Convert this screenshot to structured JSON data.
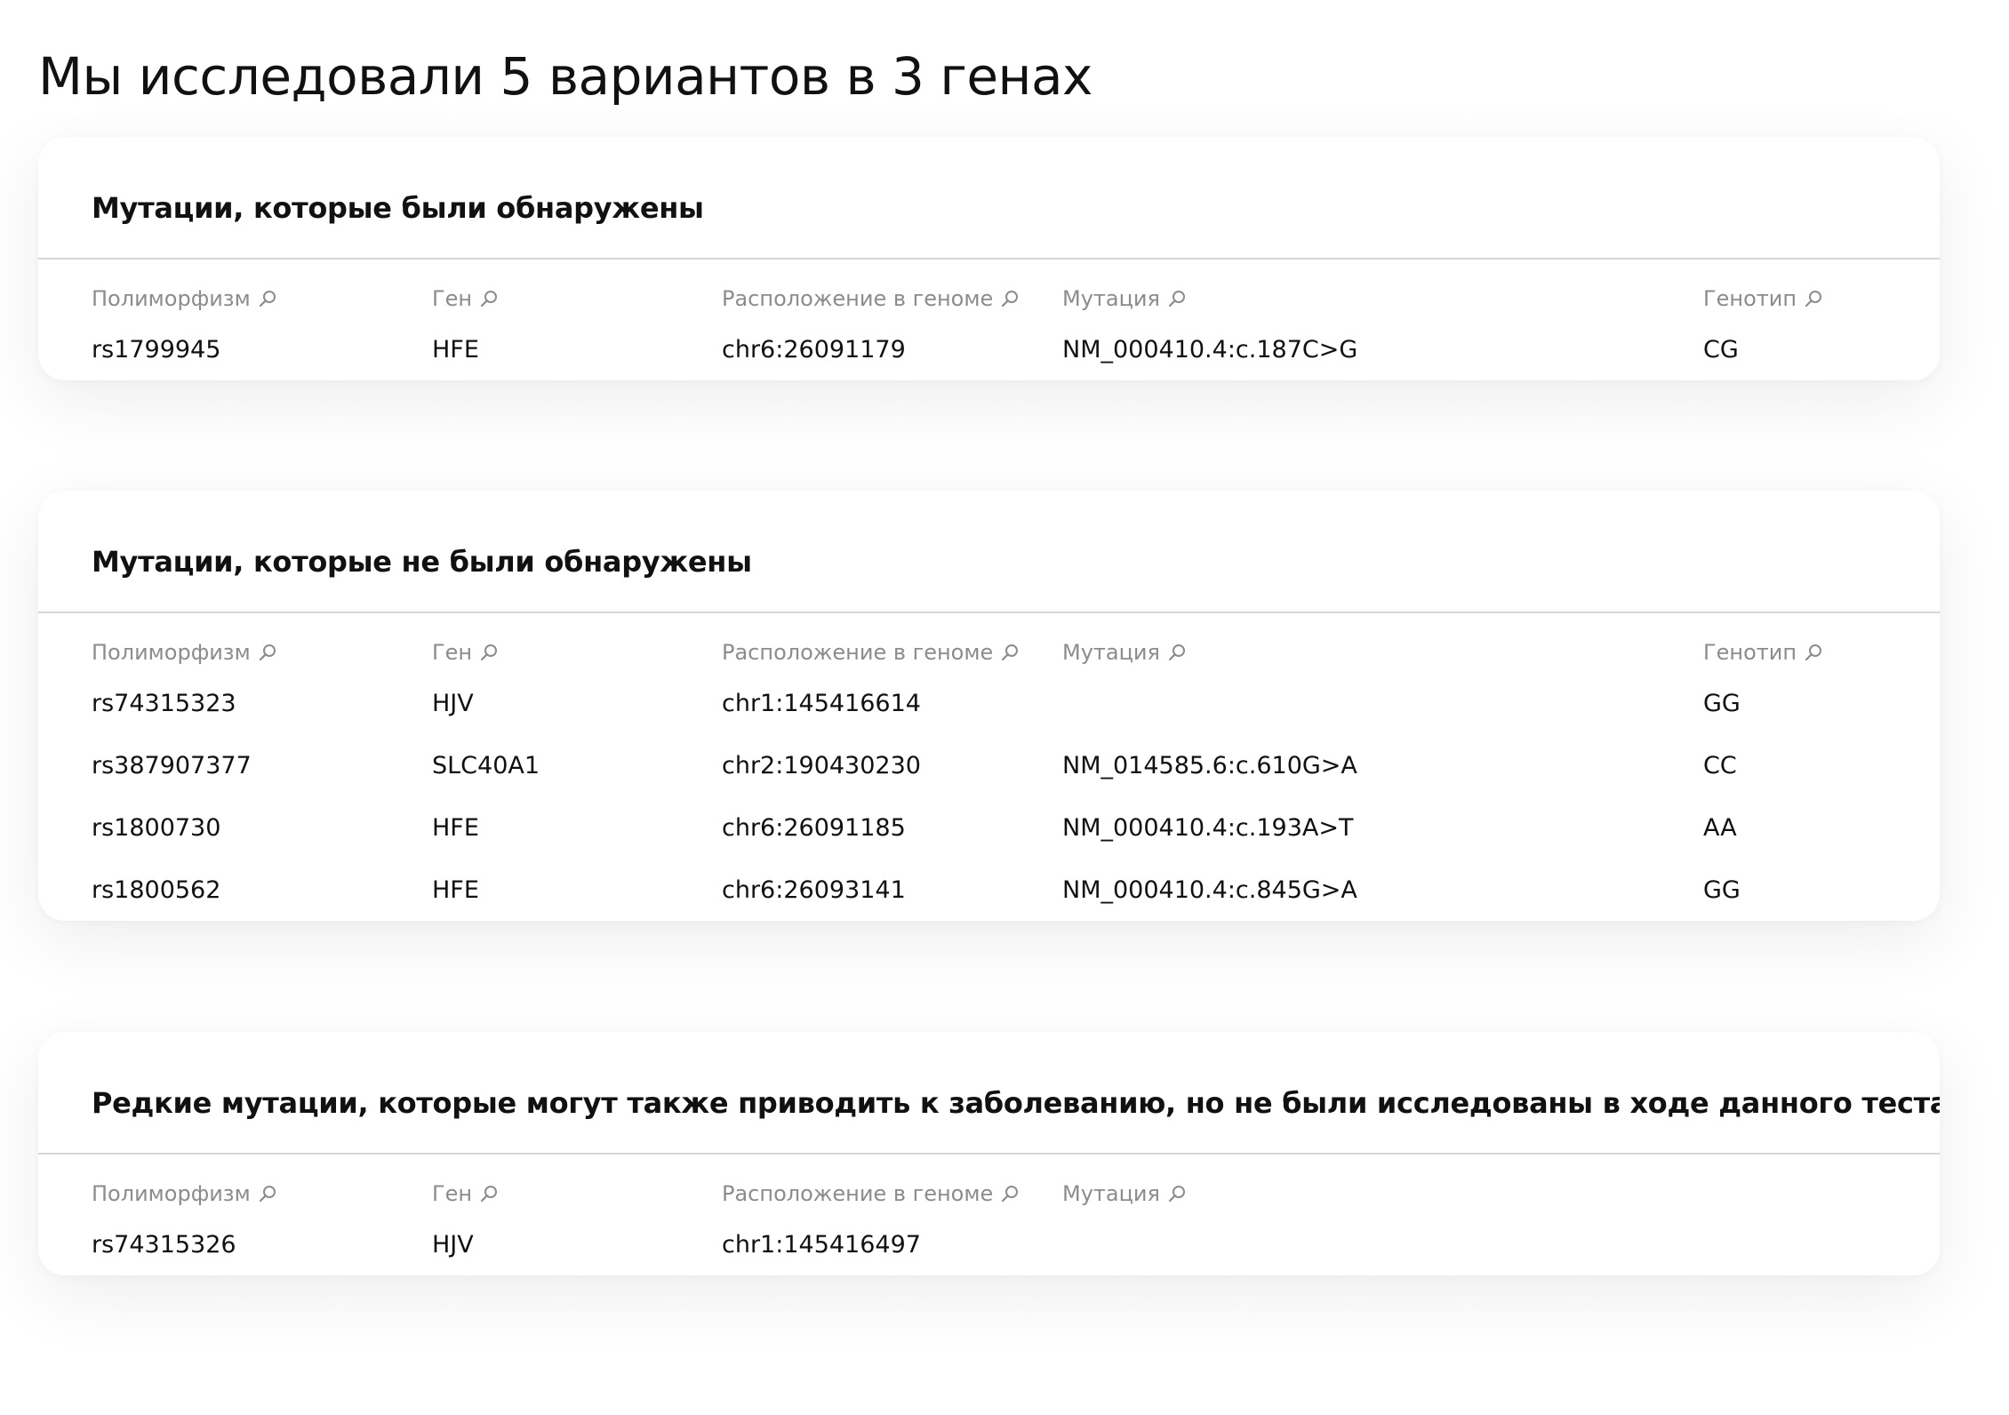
{
  "page": {
    "title": "Мы исследовали 5 вариантов в 3 генах"
  },
  "columns": {
    "polymorphism": "Полиморфизм",
    "gene": "Ген",
    "location": "Расположение в геноме",
    "mutation": "Мутация",
    "genotype": "Генотип"
  },
  "icons": {
    "column_search": "search-icon"
  },
  "sections": [
    {
      "title": "Мутации, которые были обнаружены",
      "rows": [
        {
          "polymorphism": "rs1799945",
          "gene": "HFE",
          "location": "chr6:26091179",
          "mutation": "NM_000410.4:c.187C>G",
          "genotype": "CG"
        }
      ]
    },
    {
      "title": "Мутации, которые не были обнаружены",
      "rows": [
        {
          "polymorphism": "rs74315323",
          "gene": "HJV",
          "location": "chr1:145416614",
          "mutation": "",
          "genotype": "GG"
        },
        {
          "polymorphism": "rs387907377",
          "gene": "SLC40A1",
          "location": "chr2:190430230",
          "mutation": "NM_014585.6:c.610G>A",
          "genotype": "CC"
        },
        {
          "polymorphism": "rs1800730",
          "gene": "HFE",
          "location": "chr6:26091185",
          "mutation": "NM_000410.4:c.193A>T",
          "genotype": "AA"
        },
        {
          "polymorphism": "rs1800562",
          "gene": "HFE",
          "location": "chr6:26093141",
          "mutation": "NM_000410.4:c.845G>A",
          "genotype": "GG"
        }
      ]
    },
    {
      "title": "Редкие мутации, которые могут также приводить к заболеванию, но не были исследованы в ходе данного теста",
      "rows": [
        {
          "polymorphism": "rs74315326",
          "gene": "HJV",
          "location": "chr1:145416497",
          "mutation": ""
        }
      ]
    }
  ],
  "colors": {
    "text": "#111111",
    "header_text": "#8c8c8c",
    "divider": "#d6d6d6",
    "card_background": "#ffffff"
  }
}
